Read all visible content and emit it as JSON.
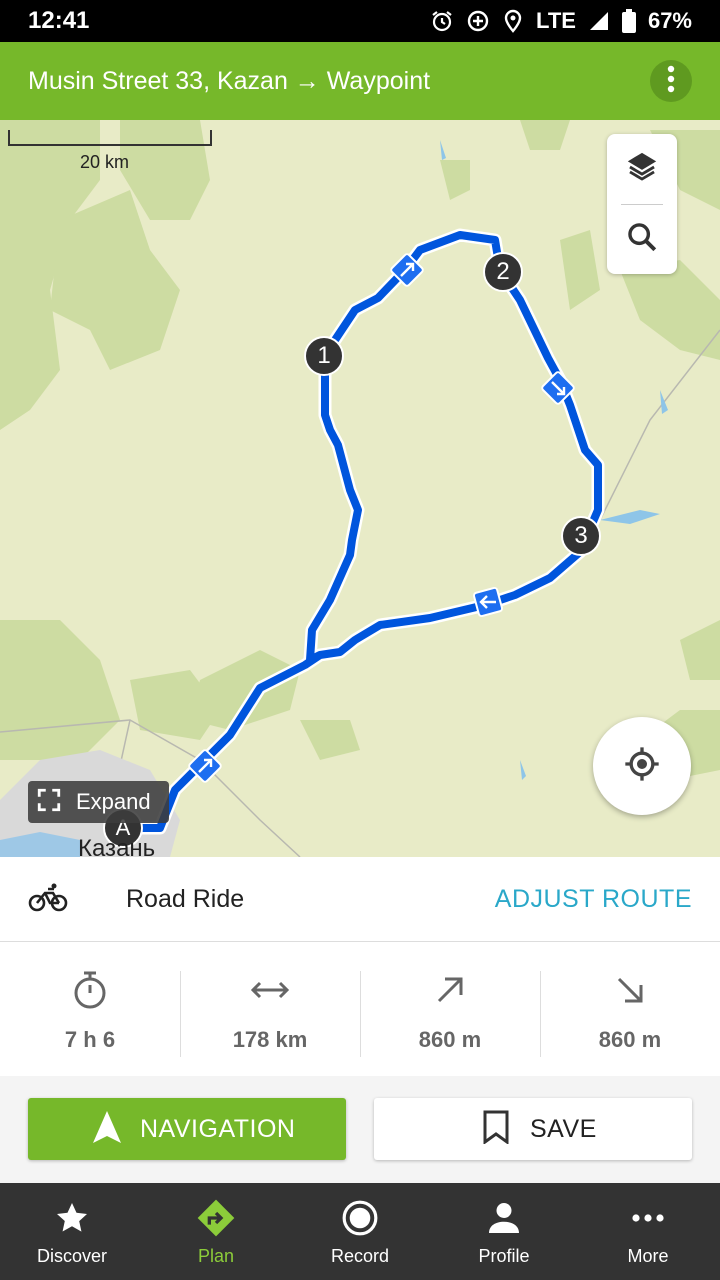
{
  "status_bar": {
    "time": "12:41",
    "network": "LTE",
    "battery": "67%"
  },
  "header": {
    "title": "Musin Street 33, Kazan → Waypoint",
    "menu_icon": "more-vert-icon"
  },
  "map": {
    "scale_label": "20 km",
    "expand_label": "Expand",
    "city_label": "Казань",
    "waypoints": [
      "A",
      "1",
      "2",
      "3"
    ],
    "route_color": "#0055dd",
    "layers_icon": "layers-icon",
    "search_icon": "search-icon",
    "locate_icon": "my-location-icon"
  },
  "sport": {
    "label": "Road Ride",
    "icon": "bicycle-icon",
    "adjust_label": "ADJUST ROUTE"
  },
  "stats": [
    {
      "icon": "stopwatch-icon",
      "value": "7 h 6"
    },
    {
      "icon": "distance-icon",
      "value": "178 km"
    },
    {
      "icon": "ascent-icon",
      "value": "860 m"
    },
    {
      "icon": "descent-icon",
      "value": "860 m"
    }
  ],
  "actions": {
    "navigation_label": "NAVIGATION",
    "save_label": "SAVE"
  },
  "bottom_nav": [
    {
      "label": "Discover",
      "icon": "star-icon"
    },
    {
      "label": "Plan",
      "icon": "plan-route-icon",
      "active": true
    },
    {
      "label": "Record",
      "icon": "record-icon"
    },
    {
      "label": "Profile",
      "icon": "person-icon"
    },
    {
      "label": "More",
      "icon": "more-horiz-icon"
    }
  ],
  "colors": {
    "brand_green": "#76b82a",
    "accent_blue": "#2aa8c9",
    "nav_bg": "#333333"
  }
}
